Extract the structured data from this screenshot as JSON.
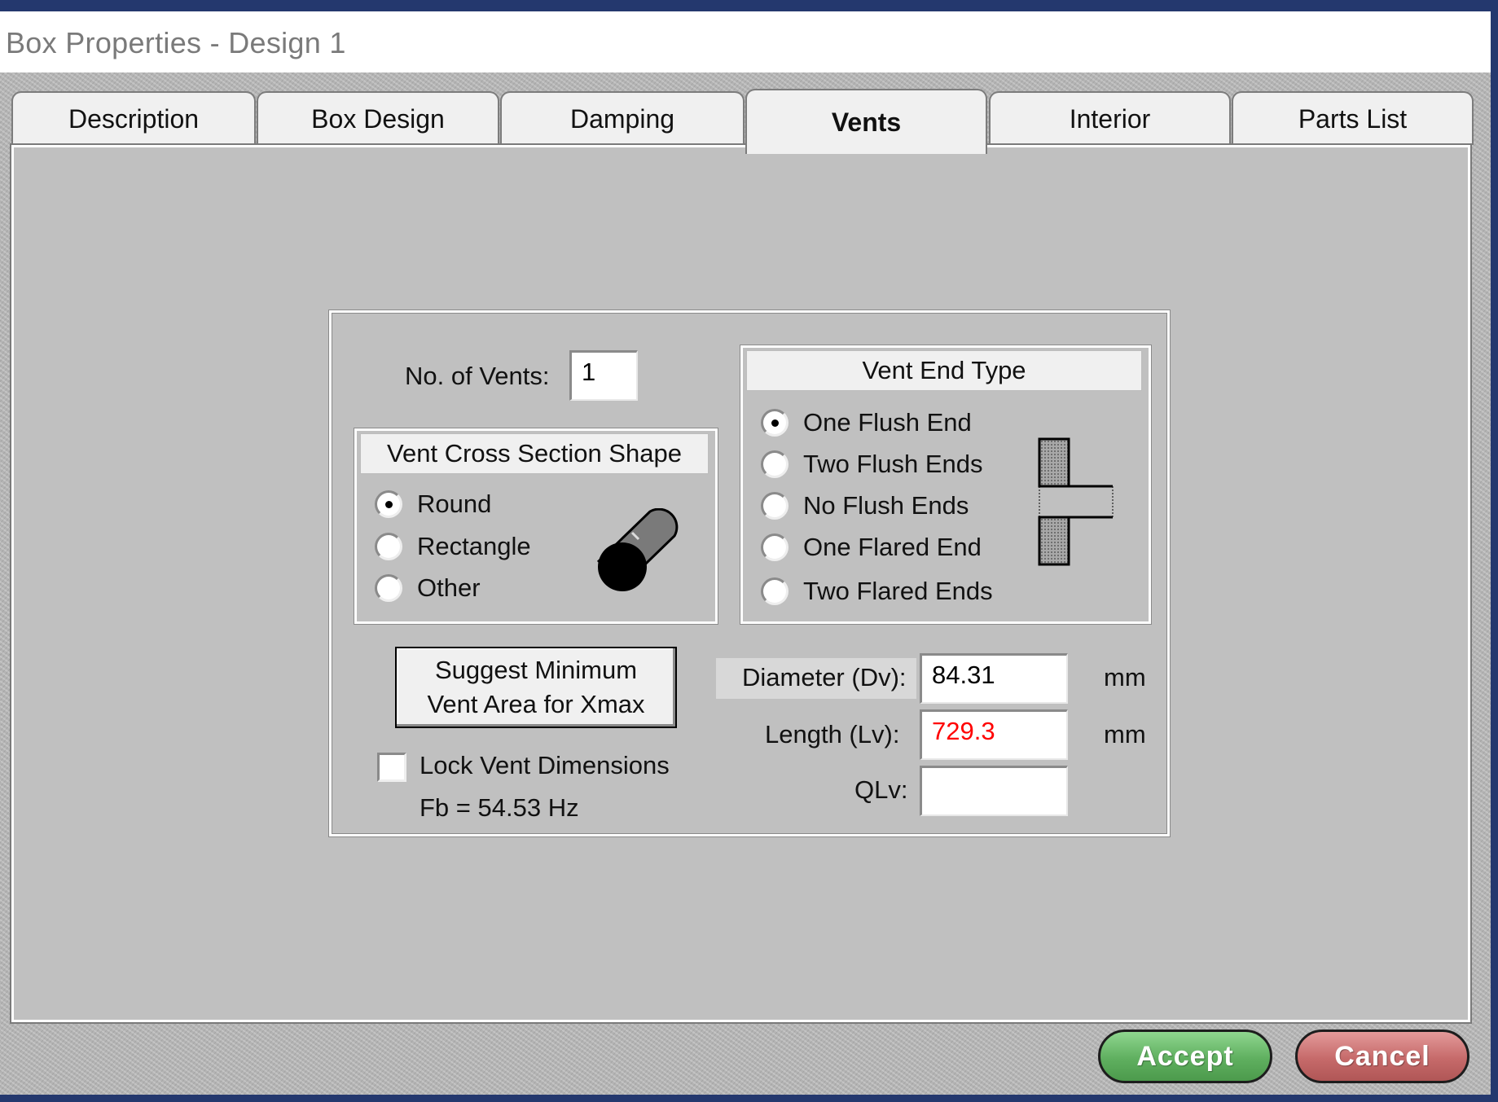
{
  "window": {
    "title": "Box Properties - Design 1"
  },
  "tabs": [
    {
      "label": "Description"
    },
    {
      "label": "Box Design"
    },
    {
      "label": "Damping"
    },
    {
      "label": "Vents",
      "active": true
    },
    {
      "label": "Interior"
    },
    {
      "label": "Parts List"
    }
  ],
  "vents": {
    "count_label": "No. of Vents:",
    "count_value": "1",
    "shape": {
      "title": "Vent Cross Section Shape",
      "options": [
        "Round",
        "Rectangle",
        "Other"
      ],
      "selected": "Round"
    },
    "end_type": {
      "title": "Vent End Type",
      "options": [
        "One Flush End",
        "Two Flush Ends",
        "No Flush Ends",
        "One Flared End",
        "Two Flared Ends"
      ],
      "selected": "One Flush End"
    },
    "suggest_button": {
      "line1": "Suggest Minimum",
      "line2": "Vent Area for Xmax"
    },
    "lock_label": "Lock Vent Dimensions",
    "lock_checked": false,
    "fb_text": "Fb = 54.53 Hz",
    "diameter": {
      "label": "Diameter (Dv):",
      "value": "84.31",
      "unit": "mm"
    },
    "length": {
      "label": "Length (Lv):",
      "value": "729.3",
      "unit": "mm",
      "value_color": "#ff0000"
    },
    "qlv": {
      "label": "QLv:",
      "value": ""
    }
  },
  "buttons": {
    "accept": "Accept",
    "cancel": "Cancel"
  },
  "colors": {
    "accept": "#5faf5f",
    "cancel": "#c66a6a",
    "panel": "#c0c0c0",
    "frame": "#24386e"
  },
  "icons": {
    "shape": "round-vent-cylinder-icon",
    "end_type": "vent-end-diagram-icon"
  }
}
